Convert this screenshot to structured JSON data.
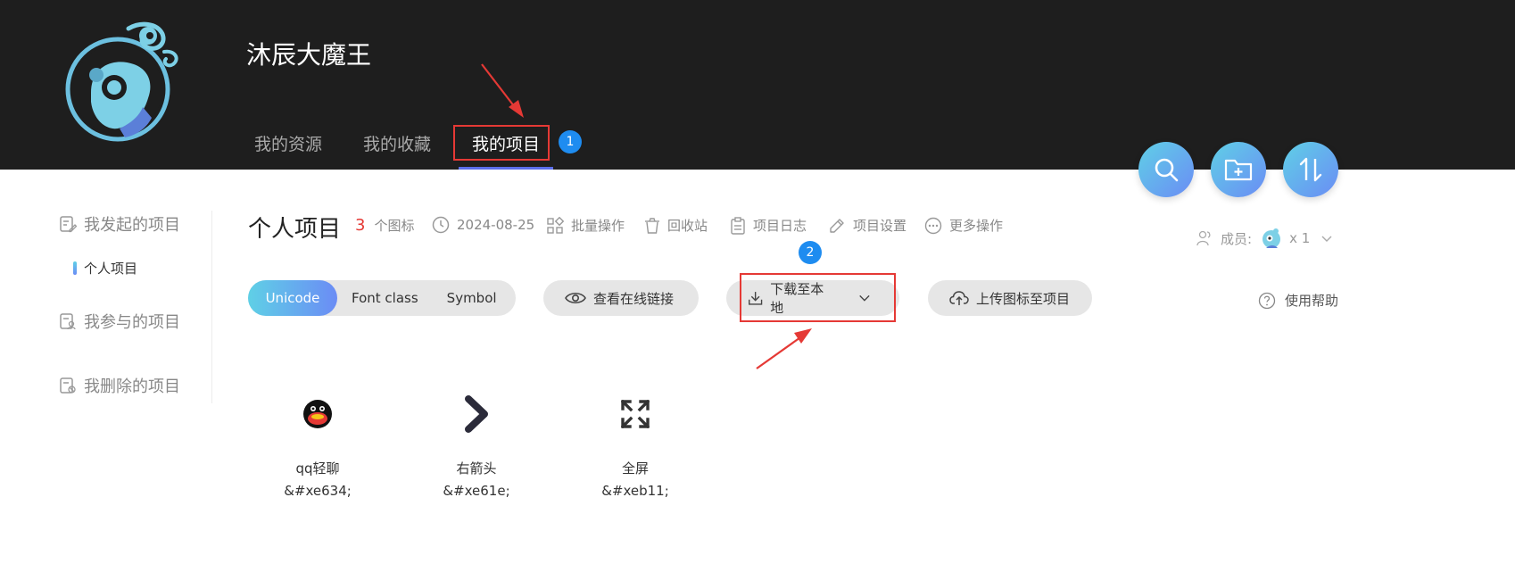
{
  "header": {
    "user_name": "沐辰大魔王",
    "tabs": [
      {
        "label": "我的资源"
      },
      {
        "label": "我的收藏"
      },
      {
        "label": "我的项目"
      }
    ],
    "step1": "1",
    "step2": "2"
  },
  "sidebar": {
    "group1": "我发起的项目",
    "sub1": "个人项目",
    "group2": "我参与的项目",
    "group3": "我删除的项目"
  },
  "project": {
    "title": "个人项目",
    "icon_count": "3",
    "icon_count_unit": "个图标",
    "date": "2024-08-25",
    "batch": "批量操作",
    "recycle": "回收站",
    "log": "项目日志",
    "settings": "项目设置",
    "more": "更多操作",
    "members_label": "成员:",
    "members_count": "x 1"
  },
  "toolbar": {
    "seg_unicode": "Unicode",
    "seg_fontclass": "Font class",
    "seg_symbol": "Symbol",
    "view_online": "查看在线链接",
    "download": "下载至本地",
    "upload": "上传图标至项目",
    "help": "使用帮助"
  },
  "icons": [
    {
      "name": "qq轻聊",
      "code": "&#xe634;"
    },
    {
      "name": "右箭头",
      "code": "&#xe61e;"
    },
    {
      "name": "全屏",
      "code": "&#xeb11;"
    }
  ],
  "colors": {
    "accent_gradient_start": "#5fd0e6",
    "accent_gradient_end": "#6b8cf5",
    "header_bg": "#1e1e1e",
    "highlight_red": "#e53935",
    "step_blue": "#1e8cf0"
  }
}
